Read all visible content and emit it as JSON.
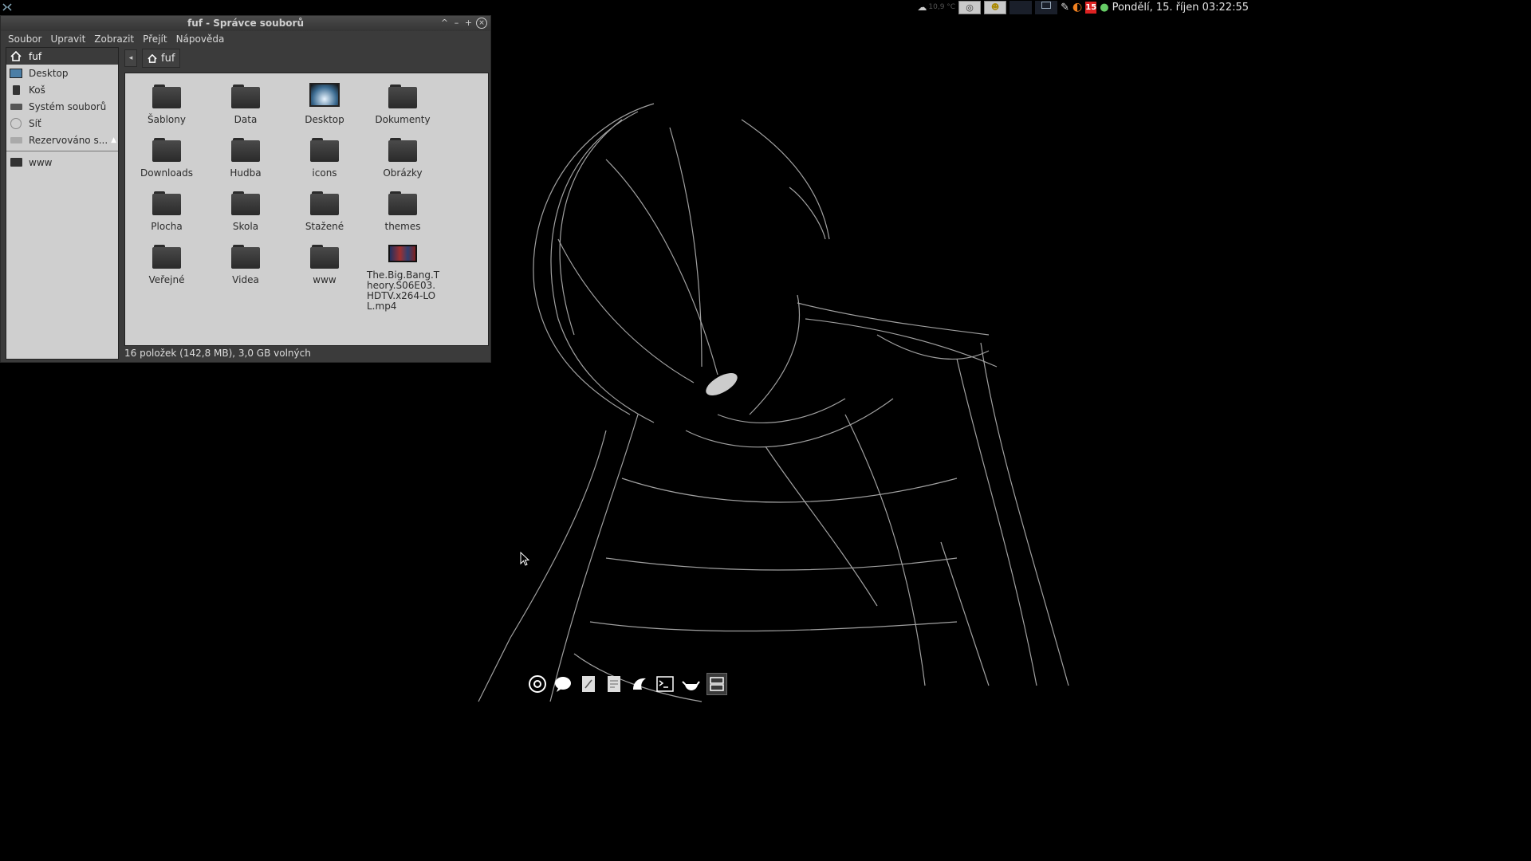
{
  "window": {
    "title": "fuf - Správce souborů",
    "menu": [
      "Soubor",
      "Upravit",
      "Zobrazit",
      "Přejít",
      "Nápověda"
    ],
    "controls": [
      "^",
      "–",
      "+",
      "×"
    ]
  },
  "sidebar": {
    "places": [
      {
        "label": "fuf",
        "icon": "home-icon",
        "active": true
      },
      {
        "label": "Desktop",
        "icon": "monitor-icon"
      },
      {
        "label": "Koš",
        "icon": "trash-icon"
      },
      {
        "label": "Systém souborů",
        "icon": "drive-icon"
      },
      {
        "label": "Síť",
        "icon": "network-icon"
      },
      {
        "label": "Rezervováno s...",
        "icon": "drive-icon",
        "eject": true
      }
    ],
    "bookmarks": [
      {
        "label": "www",
        "icon": "folder-icon"
      }
    ]
  },
  "toolbar": {
    "back": "◂",
    "location": "fuf"
  },
  "files": [
    {
      "name": "Šablony",
      "kind": "folder"
    },
    {
      "name": "Data",
      "kind": "folder"
    },
    {
      "name": "Desktop",
      "kind": "desktop"
    },
    {
      "name": "Dokumenty",
      "kind": "folder"
    },
    {
      "name": "Downloads",
      "kind": "folder"
    },
    {
      "name": "Hudba",
      "kind": "folder"
    },
    {
      "name": "icons",
      "kind": "folder"
    },
    {
      "name": "Obrázky",
      "kind": "folder"
    },
    {
      "name": "Plocha",
      "kind": "folder"
    },
    {
      "name": "Skola",
      "kind": "folder"
    },
    {
      "name": "Stažené",
      "kind": "folder"
    },
    {
      "name": "themes",
      "kind": "folder"
    },
    {
      "name": "Veřejné",
      "kind": "folder"
    },
    {
      "name": "Videa",
      "kind": "folder"
    },
    {
      "name": "www",
      "kind": "folder"
    },
    {
      "name": "The.Big.Bang.Theory.S06E03.HDTV.x264-LOL.mp4",
      "kind": "video"
    }
  ],
  "status": "16 položek (142,8 MB), 3,0 GB volných",
  "panel": {
    "weather": "10,9 °C",
    "calendar_day": "15",
    "clock": "Pondělí, 15. říjen  03:22:55"
  },
  "dock": [
    "chrome-icon",
    "chat-icon",
    "text-editor-icon",
    "document-icon",
    "tomboy-icon",
    "terminal-icon",
    "teapot-icon",
    "file-manager-icon"
  ]
}
